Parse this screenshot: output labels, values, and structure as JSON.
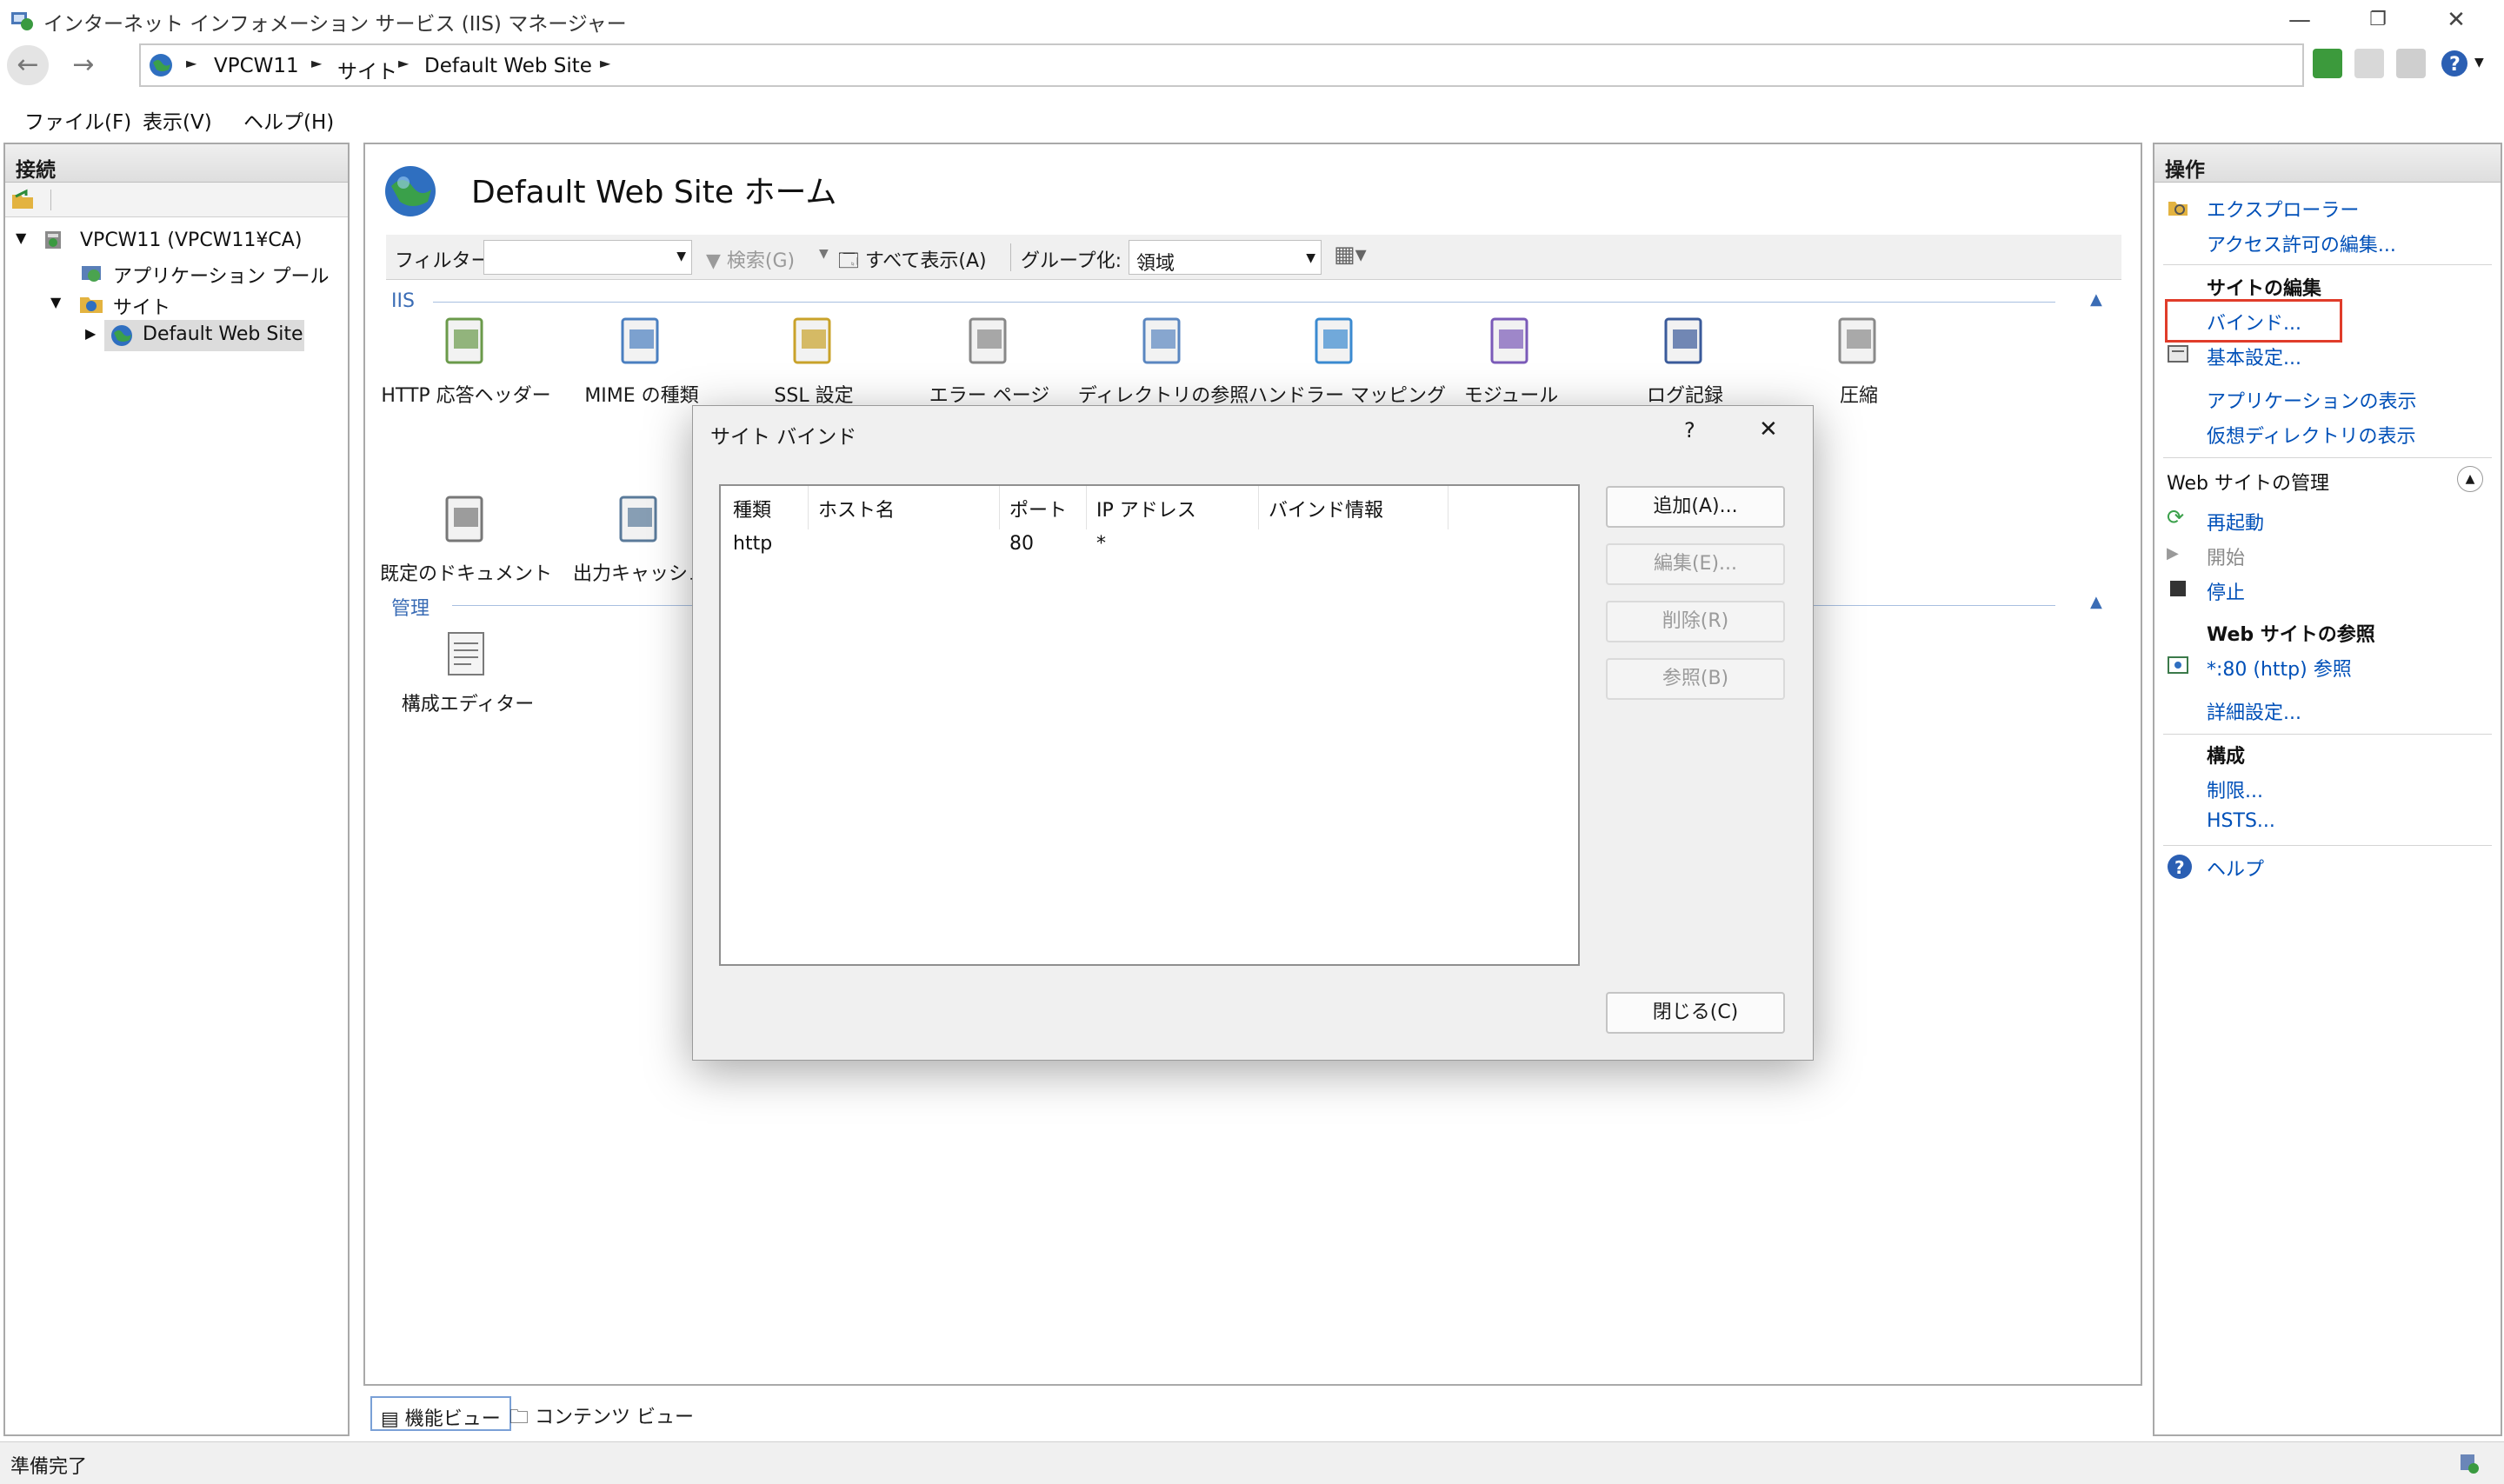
{
  "window": {
    "title": "インターネット インフォメーション サービス (IIS) マネージャー",
    "minimize": "—",
    "restore": "❐",
    "close": "✕"
  },
  "address": {
    "crumbs": [
      "VPCW11",
      "サイト",
      "Default Web Site"
    ],
    "separator": "►"
  },
  "menu": {
    "file": "ファイル(F)",
    "view": "表示(V)",
    "help": "ヘルプ(H)"
  },
  "connections": {
    "title": "接続",
    "server": "VPCW11 (VPCW11¥CA)",
    "app_pools": "アプリケーション プール",
    "sites": "サイト",
    "site": "Default Web Site"
  },
  "main": {
    "title": "Default Web Site ホーム",
    "filter_label": "フィルター:",
    "search_label": "検索(G)",
    "show_all_label": "すべて表示(A)",
    "group_label": "グループ化:",
    "group_value": "領域",
    "section_iis": "IIS",
    "section_manage": "管理",
    "features": [
      {
        "label": "HTTP 応答ヘッダー",
        "icon": "http-headers-icon"
      },
      {
        "label": "MIME の種類",
        "icon": "mime-types-icon"
      },
      {
        "label": "SSL 設定",
        "icon": "ssl-lock-icon"
      },
      {
        "label": "エラー ページ",
        "icon": "error-pages-icon"
      },
      {
        "label": "ディレクトリの参照",
        "icon": "directory-browsing-icon"
      },
      {
        "label": "ハンドラー マッピング",
        "icon": "handler-mappings-icon"
      },
      {
        "label": "モジュール",
        "icon": "modules-icon"
      },
      {
        "label": "ログ記録",
        "icon": "logging-icon"
      },
      {
        "label": "圧縮",
        "icon": "compression-icon"
      },
      {
        "label": "既定のドキュメント",
        "icon": "default-document-icon"
      },
      {
        "label": "出力キャッシュ",
        "icon": "output-caching-icon"
      }
    ],
    "manage_features": [
      {
        "label": "構成エディター",
        "icon": "config-editor-icon"
      }
    ],
    "tab_features": "機能ビュー",
    "tab_content": "コンテンツ ビュー"
  },
  "actions": {
    "title": "操作",
    "explore": "エクスプローラー",
    "edit_permissions": "アクセス許可の編集...",
    "edit_site_head": "サイトの編集",
    "bindings": "バインド...",
    "basic_settings": "基本設定...",
    "view_apps": "アプリケーションの表示",
    "view_vdirs": "仮想ディレクトリの表示",
    "manage_site_head": "Web サイトの管理",
    "restart": "再起動",
    "start": "開始",
    "stop": "停止",
    "browse_head": "Web サイトの参照",
    "browse_80": "*:80 (http) 参照",
    "advanced": "詳細設定...",
    "config_head": "構成",
    "limits": "制限...",
    "hsts": "HSTS...",
    "help": "ヘルプ",
    "highlight_color": "#e03c2a"
  },
  "status": {
    "text": "準備完了"
  },
  "dialog": {
    "title": "サイト バインド",
    "help": "?",
    "close_x": "✕",
    "columns": [
      "種類",
      "ホスト名",
      "ポート",
      "IP アドレス",
      "バインド情報"
    ],
    "rows": [
      {
        "type": "http",
        "host": "",
        "port": "80",
        "ip": "*",
        "info": ""
      }
    ],
    "add": "追加(A)...",
    "edit": "編集(E)...",
    "remove": "削除(R)",
    "browse": "参照(B)",
    "close": "閉じる(C)"
  }
}
